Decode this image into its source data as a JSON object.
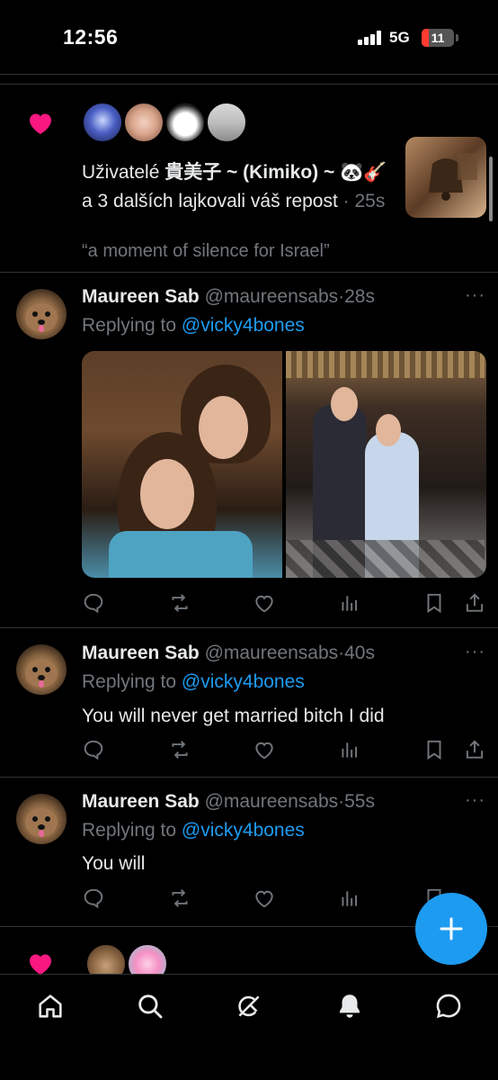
{
  "status_bar": {
    "time": "12:56",
    "network": "5G",
    "battery": "11"
  },
  "notification": {
    "text_prefix": "Uživatelé ",
    "user_name": "貴美子 ~ (Kimiko) ~ 🐼🎸",
    "text_suffix": " a 3 dalších lajkovali váš repost",
    "time": " · 25s",
    "quote": "“a moment of silence for Israel”"
  },
  "tweets": [
    {
      "name": "Maureen Sab",
      "handle": "@maureensabs",
      "time": "·28s",
      "replying_prefix": "Replying to ",
      "replying_to": "@vicky4bones",
      "text": ""
    },
    {
      "name": "Maureen Sab",
      "handle": "@maureensabs",
      "time": "·40s",
      "replying_prefix": "Replying to ",
      "replying_to": "@vicky4bones",
      "text": "You will never get married bitch I did"
    },
    {
      "name": "Maureen Sab",
      "handle": "@maureensabs",
      "time": "·55s",
      "replying_prefix": "Replying to ",
      "replying_to": "@vicky4bones",
      "text": "You will"
    }
  ],
  "more_glyph": "···",
  "colors": {
    "accent": "#1d9bf0",
    "like": "#f91880",
    "muted": "#71767b",
    "text": "#e7e9ea",
    "divider": "#2f3336"
  },
  "icons": {
    "actions": [
      "reply-icon",
      "retweet-icon",
      "like-icon",
      "views-icon",
      "bookmark-icon",
      "share-icon"
    ],
    "nav": [
      "home-icon",
      "search-icon",
      "grok-icon",
      "notifications-icon",
      "messages-icon"
    ],
    "fab": "plus-icon"
  }
}
